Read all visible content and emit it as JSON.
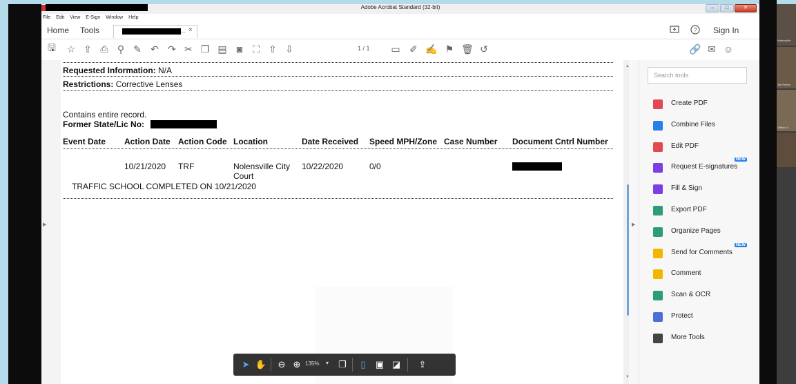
{
  "window": {
    "title": "Adobe Acrobat Standard (32-bit)",
    "controls": [
      "–",
      "□",
      "✕"
    ]
  },
  "menubar": [
    "File",
    "Edit",
    "View",
    "E-Sign",
    "Window",
    "Help"
  ],
  "tabs": {
    "home": "Home",
    "tools": "Tools",
    "doc_suffix": "...",
    "close": "×",
    "sign_in": "Sign In"
  },
  "toolbar": {
    "page_indicator": "1 / 1",
    "icons": [
      "save-icon",
      "bookmark-star-icon",
      "upload-cloud-icon",
      "print-icon",
      "zoom-search-icon",
      "edit-pdf-icon",
      "undo-icon",
      "redo-icon",
      "cut-icon",
      "copy-icon",
      "paste-icon",
      "screenshot-icon",
      "find-icon",
      "prev-page-icon",
      "next-page-icon",
      "comment-icon",
      "pen-icon",
      "sign-icon",
      "stamp-icon",
      "trash-icon",
      "rotate-icon"
    ]
  },
  "document": {
    "requested_info_label": "Requested Information:",
    "requested_info_value": "N/A",
    "restrictions_label": "Restrictions:",
    "restrictions_value": "Corrective Lenses",
    "contains_record": "Contains entire record.",
    "former_state_label": "Former State/Lic No:",
    "table_headers": [
      "Event Date",
      "Action Date",
      "Action Code",
      "Location",
      "Date Received",
      "Speed MPH/Zone",
      "Case Number",
      "Document Cntrl Number"
    ],
    "row": {
      "event_date": "",
      "action_date": "10/21/2020",
      "action_code": "TRF",
      "location_line1": "Nolensville City",
      "location_line2": "Court",
      "date_received": "10/22/2020",
      "speed": "0/0",
      "case_number": ""
    },
    "note": "TRAFFIC SCHOOL COMPLETED ON 10/21/2020"
  },
  "float_toolbar": {
    "zoom": "135%"
  },
  "tools_panel": {
    "search_placeholder": "Search tools",
    "items": [
      {
        "label": "Create PDF",
        "icon": "create-pdf-icon",
        "color": "#e34850"
      },
      {
        "label": "Combine Files",
        "icon": "combine-files-icon",
        "color": "#2680eb"
      },
      {
        "label": "Edit PDF",
        "icon": "edit-pdf-tool-icon",
        "color": "#e34850"
      },
      {
        "label": "Request E-signatures",
        "icon": "request-esign-icon",
        "color": "#7b3fe4",
        "badge": "NEW"
      },
      {
        "label": "Fill & Sign",
        "icon": "fill-sign-icon",
        "color": "#7b3fe4"
      },
      {
        "label": "Export PDF",
        "icon": "export-pdf-icon",
        "color": "#2d9d78"
      },
      {
        "label": "Organize Pages",
        "icon": "organize-pages-icon",
        "color": "#2d9d78"
      },
      {
        "label": "Send for Comments",
        "icon": "send-comments-icon",
        "color": "#f2b600",
        "badge": "NEW"
      },
      {
        "label": "Comment",
        "icon": "comment-tool-icon",
        "color": "#f2b600"
      },
      {
        "label": "Scan & OCR",
        "icon": "scan-ocr-icon",
        "color": "#2d9d78"
      },
      {
        "label": "Protect",
        "icon": "protect-icon",
        "color": "#4a6fd6"
      },
      {
        "label": "More Tools",
        "icon": "more-tools-icon",
        "color": "#444444"
      }
    ]
  },
  "side_thumbnails": [
    "Nolensville",
    "Jim Peters",
    "Officer G"
  ]
}
